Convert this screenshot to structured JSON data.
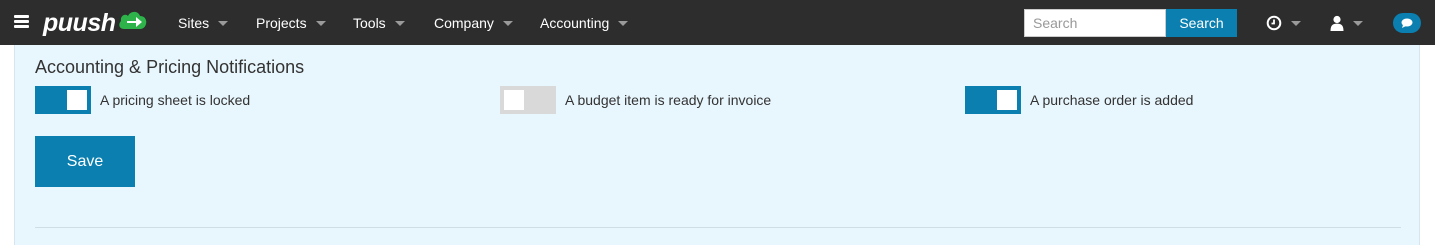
{
  "navbar": {
    "logo_text": "puush",
    "items": [
      {
        "label": "Sites"
      },
      {
        "label": "Projects"
      },
      {
        "label": "Tools"
      },
      {
        "label": "Company"
      },
      {
        "label": "Accounting"
      }
    ],
    "search": {
      "placeholder": "Search",
      "value": "",
      "button_label": "Search"
    },
    "icons": [
      "menu-icon",
      "clock-icon",
      "user-icon",
      "chat-icon"
    ],
    "colors": {
      "bar": "#2d2d2d",
      "accent": "#0a7fb0",
      "logo_green": "#2db34a"
    }
  },
  "section": {
    "title": "Accounting & Pricing Notifications",
    "toggles": [
      {
        "label": "A pricing sheet is locked",
        "on": true
      },
      {
        "label": "A budget item is ready for invoice",
        "on": false
      },
      {
        "label": "A purchase order is added",
        "on": true
      }
    ],
    "save_label": "Save",
    "background": "#e8f6fd"
  }
}
